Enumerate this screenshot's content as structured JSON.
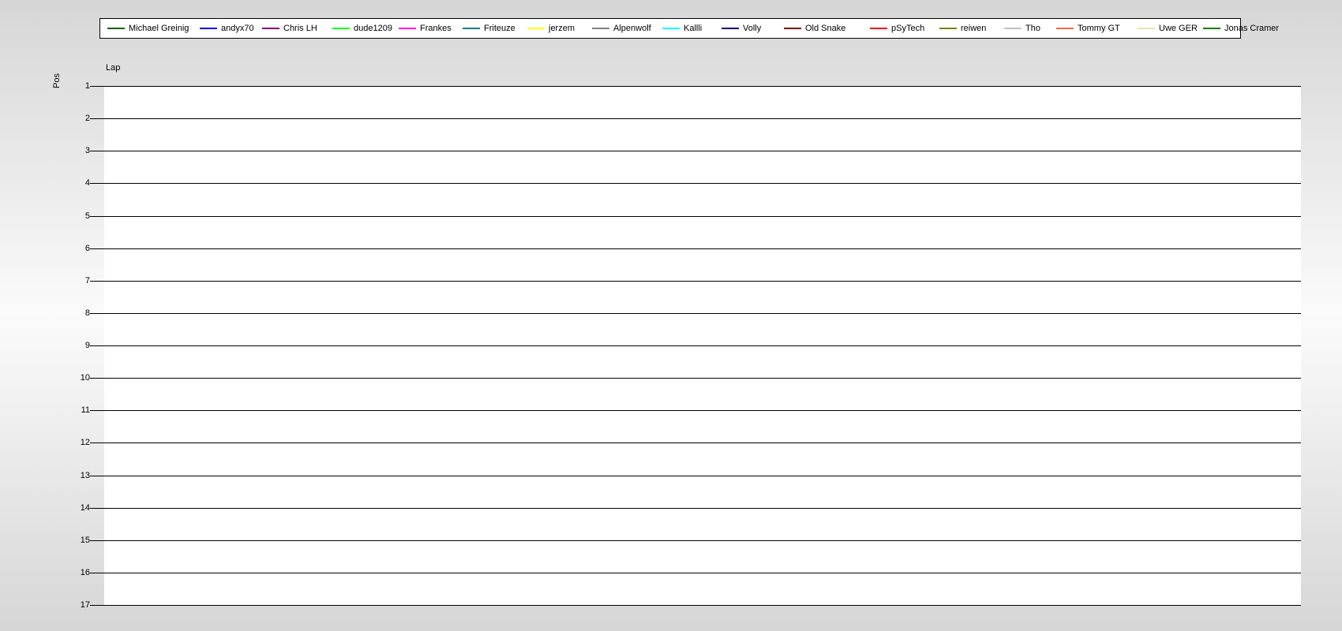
{
  "chart_data": {
    "type": "line",
    "title": "",
    "xlabel": "Lap",
    "ylabel": "Pos",
    "y_ticks": [
      "1",
      "2",
      "3",
      "4",
      "5",
      "6",
      "7",
      "8",
      "9",
      "10",
      "11",
      "12",
      "13",
      "14",
      "15",
      "16",
      "17"
    ],
    "ylim": [
      1,
      17
    ],
    "y_inverted": true,
    "grid": true,
    "legend_position": "top",
    "series": [
      {
        "name": "Michael Greinig",
        "color": "#006400",
        "values": []
      },
      {
        "name": "andyx70",
        "color": "#0000ff",
        "values": []
      },
      {
        "name": "Chris LH",
        "color": "#800080",
        "values": []
      },
      {
        "name": "dude1209",
        "color": "#00ff00",
        "values": []
      },
      {
        "name": "Frankes",
        "color": "#ff00ff",
        "values": []
      },
      {
        "name": "Friteuze",
        "color": "#008080",
        "values": []
      },
      {
        "name": "jerzem",
        "color": "#ffff00",
        "values": []
      },
      {
        "name": "Alpenwolf",
        "color": "#808080",
        "values": []
      },
      {
        "name": "Kallli",
        "color": "#00ffff",
        "values": []
      },
      {
        "name": "Volly",
        "color": "#000080",
        "values": []
      },
      {
        "name": "Old Snake",
        "color": "#800000",
        "values": []
      },
      {
        "name": "pSyTech",
        "color": "#ff0000",
        "values": []
      },
      {
        "name": "reiwen",
        "color": "#808000",
        "values": []
      },
      {
        "name": "Tho",
        "color": "#c0c0c0",
        "values": []
      },
      {
        "name": "Tommy GT",
        "color": "#ff6347",
        "values": []
      },
      {
        "name": "Uwe GER",
        "color": "#f5deb3",
        "values": []
      },
      {
        "name": "Jonas Cramer",
        "color": "#008000",
        "values": []
      }
    ]
  }
}
